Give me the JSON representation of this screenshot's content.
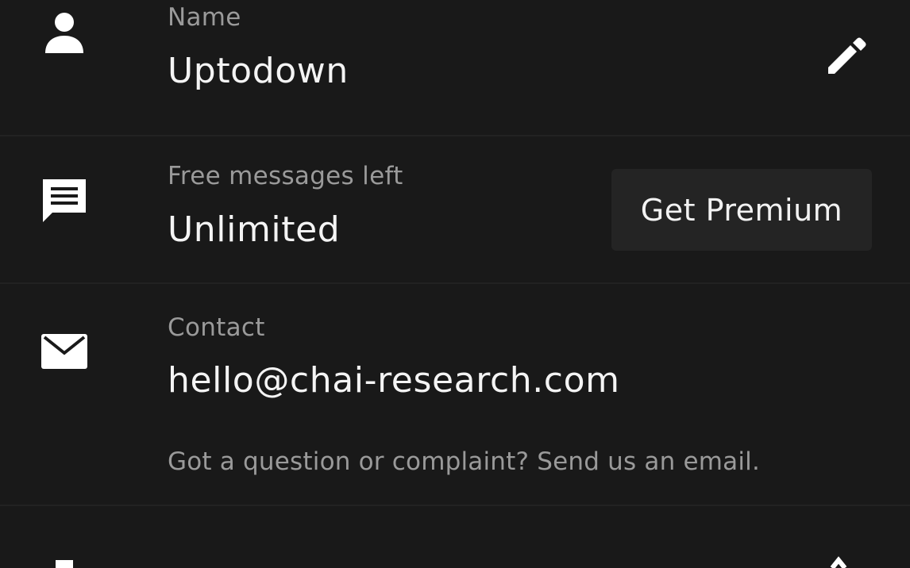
{
  "profile": {
    "name": {
      "label": "Name",
      "value": "Uptodown",
      "icon": "person-icon",
      "action_icon": "pencil-icon"
    },
    "messages": {
      "label": "Free messages left",
      "value": "Unlimited",
      "icon": "chat-icon",
      "button_label": "Get Premium"
    },
    "contact": {
      "label": "Contact",
      "value": "hello@chai-research.com",
      "hint": "Got a question or complaint? Send us an email.",
      "icon": "mail-icon"
    },
    "next_row": {
      "icon": "cut-off-icon",
      "action_icon": "chevron-right-icon"
    }
  },
  "colors": {
    "background": "#191919",
    "divider": "#222222",
    "label": "#9a9a9a",
    "value": "#f4f4f4",
    "button_bg": "#242424"
  }
}
